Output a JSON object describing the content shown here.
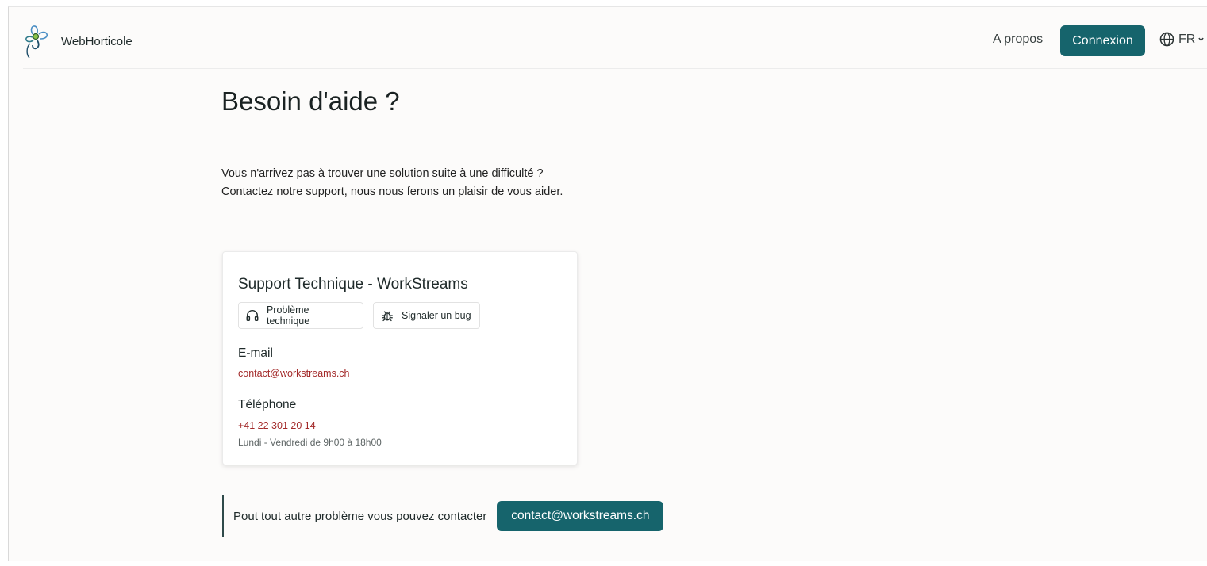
{
  "header": {
    "brand_name": "WebHorticole",
    "nav_about": "A propos",
    "login_button": "Connexion",
    "language": "FR"
  },
  "main": {
    "title": "Besoin d'aide ?",
    "intro_line1": "Vous n'arrivez pas à trouver une solution suite à une difficulté ?",
    "intro_line2": "Contactez notre support, nous nous ferons un plaisir de vous aider."
  },
  "card": {
    "title": "Support Technique - WorkStreams",
    "chips": [
      {
        "label": "Problème technique",
        "icon": "headphones-icon"
      },
      {
        "label": "Signaler un bug",
        "icon": "bug-icon"
      }
    ],
    "email_label": "E-mail",
    "email": "contact@workstreams.ch",
    "phone_label": "Téléphone",
    "phone": "+41 22 301 20 14",
    "hours": "Lundi - Vendredi de 9h00 à 18h00"
  },
  "footer": {
    "text": "Pout tout autre problème vous pouvez contacter",
    "contact_button": "contact@workstreams.ch"
  },
  "colors": {
    "primary": "#16646c",
    "link_red": "#a32a2a",
    "background": "#fcfbfa"
  }
}
